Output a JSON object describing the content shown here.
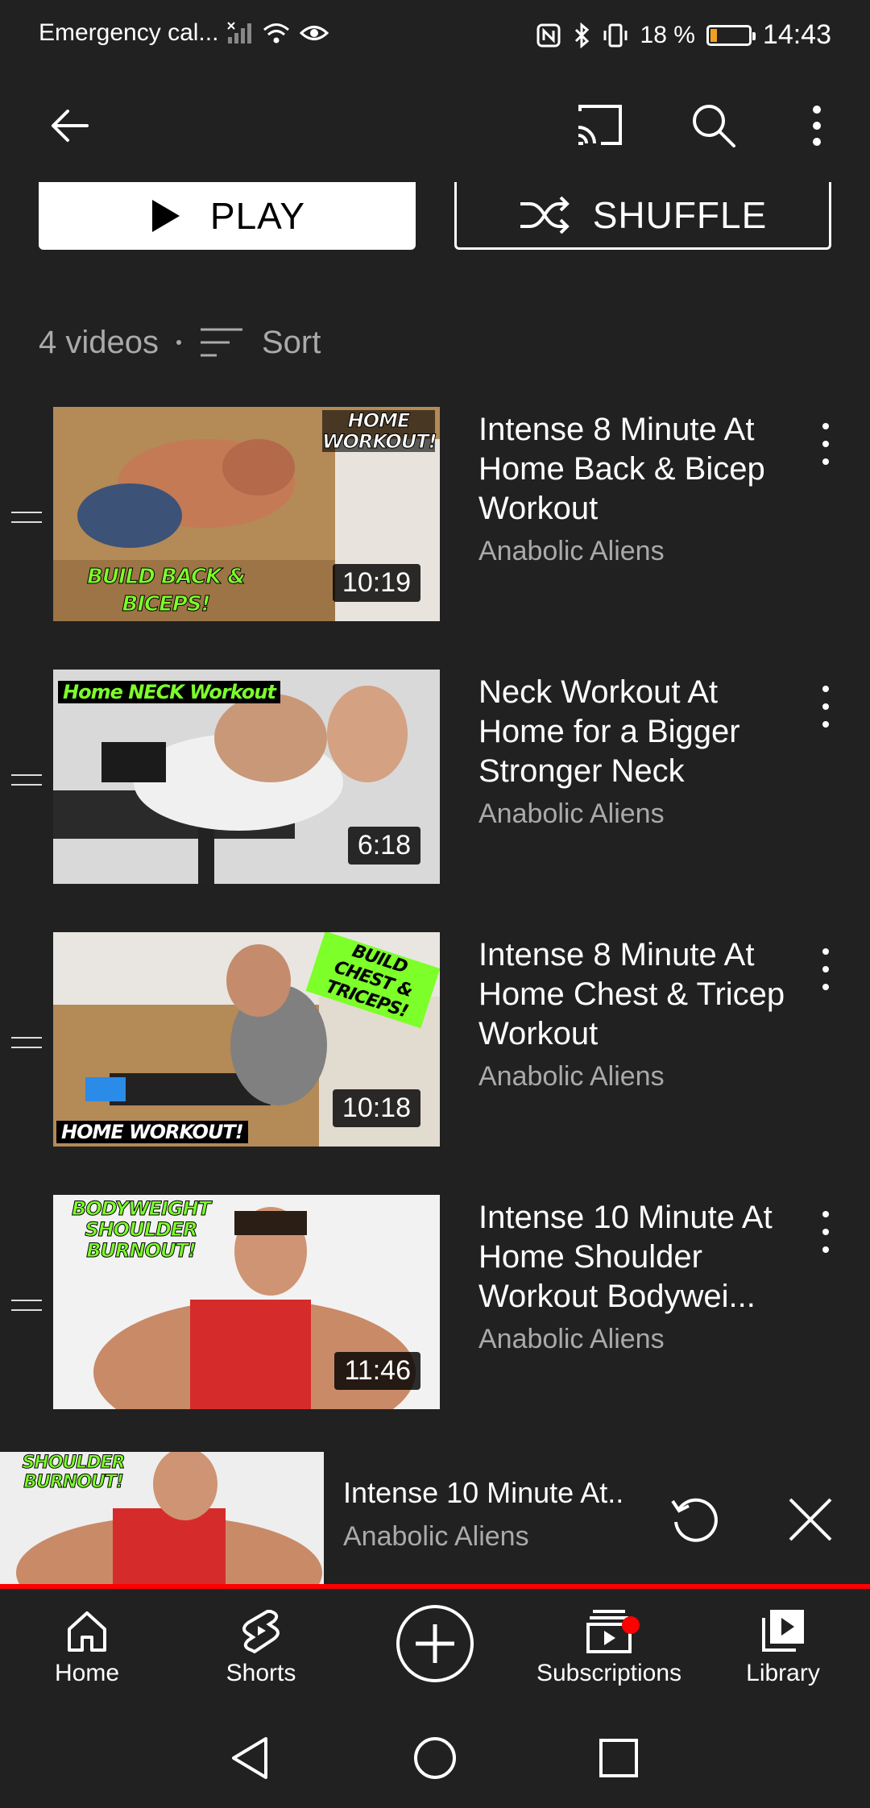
{
  "status_bar": {
    "carrier": "Emergency cal...",
    "battery": "18 %",
    "battery_level": 0.18,
    "time": "14:43"
  },
  "app_bar": {
    "back_icon": "arrow-left-icon",
    "cast_icon": "cast-icon",
    "search_icon": "search-icon",
    "more_icon": "more-vert-icon"
  },
  "actions": {
    "play_label": "PLAY",
    "shuffle_label": "SHUFFLE"
  },
  "meta": {
    "count": "4 videos",
    "sort_label": "Sort"
  },
  "videos": [
    {
      "title": "Intense 8 Minute At Home Back & Bicep Workout",
      "channel": "Anabolic Aliens",
      "duration": "10:19",
      "thumb_text_1": "HOME WORKOUT!",
      "thumb_text_2": "BUILD BACK & BICEPS!"
    },
    {
      "title": "Neck Workout At Home for a Bigger Stronger Neck",
      "channel": "Anabolic Aliens",
      "duration": "6:18",
      "thumb_text_1": "Home NECK Workout"
    },
    {
      "title": "Intense 8 Minute At Home Chest & Tricep Workout",
      "channel": "Anabolic Aliens",
      "duration": "10:18",
      "thumb_text_1": "BUILD CHEST & TRICEPS!",
      "thumb_text_2": "HOME WORKOUT!"
    },
    {
      "title": "Intense 10 Minute At Home Shoulder Workout Bodywei...",
      "channel": "Anabolic Aliens",
      "duration": "11:46",
      "thumb_text_1": "BODYWEIGHT SHOULDER BURNOUT!"
    }
  ],
  "mini_player": {
    "title": "Intense 10 Minute At..",
    "channel": "Anabolic Aliens",
    "thumb_text": "SHOULDER BURNOUT!"
  },
  "bottom_nav": {
    "home": "Home",
    "shorts": "Shorts",
    "subscriptions": "Subscriptions",
    "library": "Library"
  },
  "colors": {
    "background": "#212121",
    "accent": "#ff0000",
    "secondary_text": "#aaaaaa"
  }
}
